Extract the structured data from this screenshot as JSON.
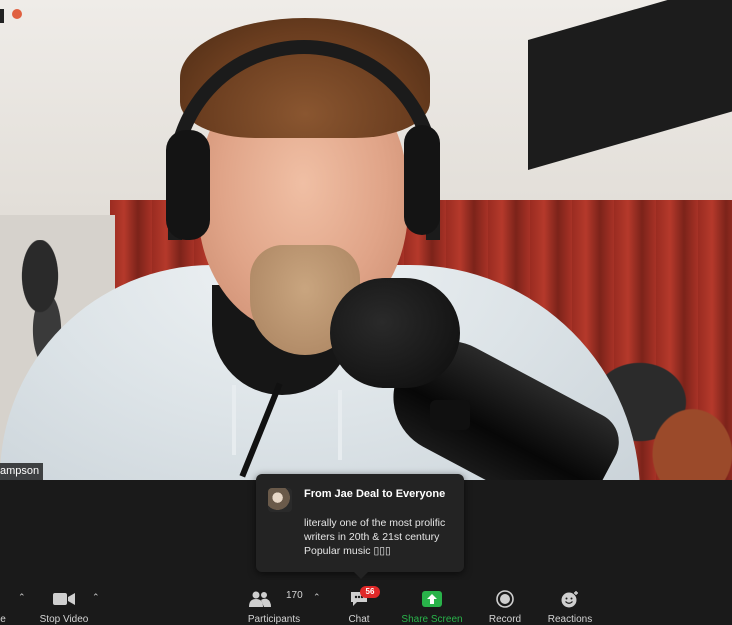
{
  "video": {
    "participant_name_tag": "ampson"
  },
  "chat_popup": {
    "from": "From Jae Deal to Everyone",
    "message": "literally one of the most prolific writers in 20th & 21st century Popular music ▯▯▯"
  },
  "toolbar": {
    "cut_left_label": "e",
    "stop_video_label": "Stop Video",
    "participants_label": "Participants",
    "participants_count": "170",
    "chat_label": "Chat",
    "chat_badge": "56",
    "share_screen_label": "Share Screen",
    "record_label": "Record",
    "reactions_label": "Reactions"
  },
  "colors": {
    "share_screen_accent": "#29b34a",
    "badge_red": "#e02828"
  }
}
